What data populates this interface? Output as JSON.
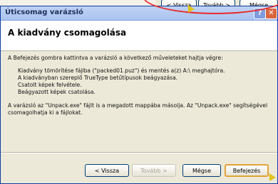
{
  "background_dialog": {
    "buttons": [
      "< Vissza",
      "Tovább >",
      "Mégse"
    ]
  },
  "window": {
    "title": "Úticsomag varázsló"
  },
  "header": {
    "heading": "A kiadvány csomagolása"
  },
  "content": {
    "intro": "A Befejezés gombra kattintva a varázsló a következő műveleteket hajtja végre:",
    "actions": [
      "Kiadvány tömörítése fájlba (\"packed01.puz\") és mentés a(z) A:\\ meghajtóra.",
      "A kiadványban szereplő TrueType betűtípusok beágyazása.",
      "Csatolt képek felvétele.",
      "Beágyazott képek csatolása."
    ],
    "note": "A varázsló az \"Unpack.exe\" fájlt is a megadott mappába másolja. Az \"Unpack.exe\" segítségével csomagolhatja ki a fájlokat."
  },
  "footer": {
    "back_label": "< Vissza",
    "next_label": "Tovább >",
    "cancel_label": "Mégse",
    "finish_label": "Befejezés"
  }
}
